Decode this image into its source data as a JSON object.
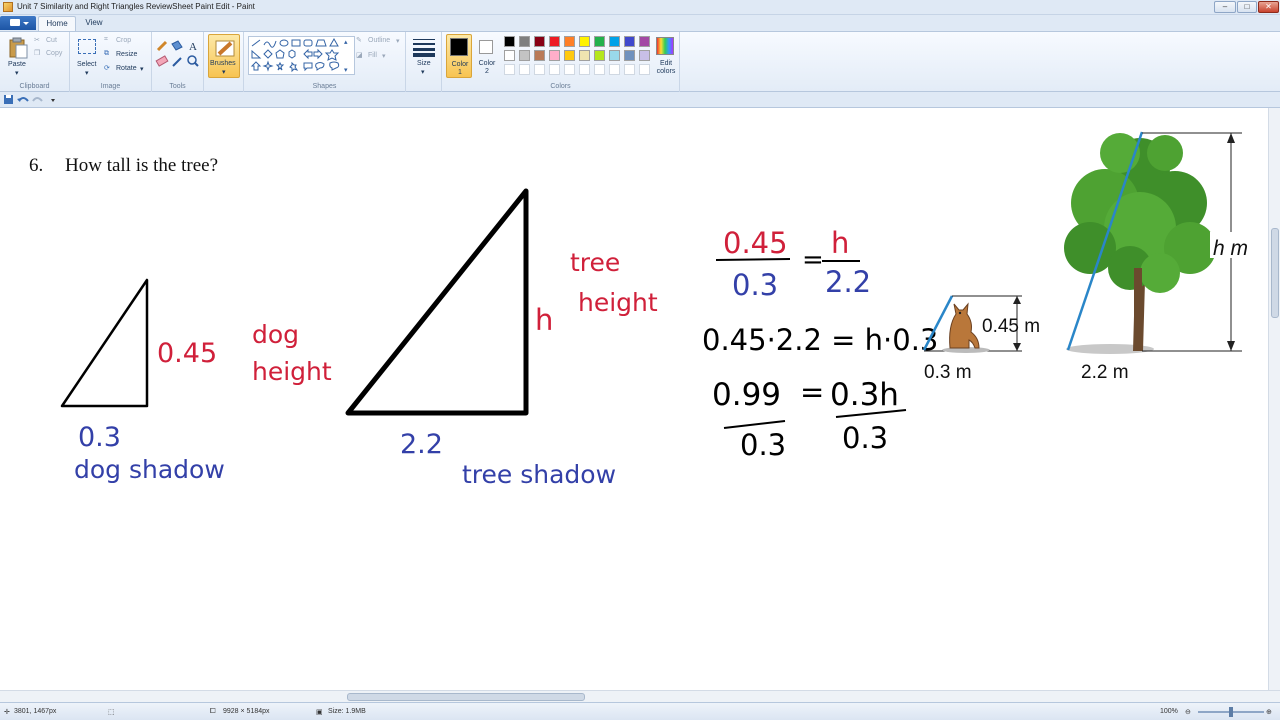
{
  "window": {
    "title": "Unit 7 Similarity and Right Triangles ReviewSheet Paint Edit - Paint"
  },
  "tabs": {
    "home": "Home",
    "view": "View"
  },
  "ribbon": {
    "clipboard": {
      "paste": "Paste",
      "cut": "Cut",
      "copy": "Copy",
      "label": "Clipboard"
    },
    "image": {
      "select": "Select",
      "crop": "Crop",
      "resize": "Resize",
      "rotate": "Rotate",
      "label": "Image"
    },
    "tools": {
      "label": "Tools"
    },
    "brushes": {
      "label": "Brushes"
    },
    "shapes": {
      "outline": "Outline",
      "fill": "Fill",
      "label": "Shapes"
    },
    "size": {
      "label": "Size"
    },
    "colors": {
      "color1": "Color 1",
      "color2": "Color 2",
      "edit": "Edit colors",
      "label": "Colors",
      "palette": [
        "#000000",
        "#7f7f7f",
        "#880015",
        "#ed1c24",
        "#ff7f27",
        "#fff200",
        "#22b14c",
        "#00a2e8",
        "#3f48cc",
        "#a349a4",
        "#ffffff",
        "#c3c3c3",
        "#b97a57",
        "#ffaec9",
        "#ffc90e",
        "#efe4b0",
        "#b5e61d",
        "#99d9ea",
        "#7092be",
        "#c8bfe7"
      ]
    }
  },
  "canvas": {
    "question_number": "6.",
    "question_text": "How tall is the tree?",
    "small_triangle": {
      "side": "0.45",
      "base": "0.3",
      "side_note_1": "dog",
      "side_note_2": "height",
      "base_note": "dog shadow"
    },
    "large_triangle": {
      "side": "h",
      "base": "2.2",
      "side_note_1": "tree",
      "side_note_2": "height",
      "base_note": "tree shadow"
    },
    "work": {
      "line1_num_left": "0.45",
      "line1_den_left": "0.3",
      "line1_eq": "=",
      "line1_num_right": "h",
      "line1_den_right": "2.2",
      "line2": "0.45·2.2 = h·0.3",
      "line3_left": "0.99",
      "line3_eq": "=",
      "line3_right": "0.3h",
      "line3_den_left": "0.3",
      "line3_den_right": "0.3"
    },
    "figure": {
      "dog_height": "0.45 m",
      "dog_shadow": "0.3 m",
      "tree_height": "h m",
      "tree_shadow": "2.2 m"
    }
  },
  "status": {
    "cursor": "3801, 1467px",
    "dimensions": "9928 × 5184px",
    "size": "Size: 1.9MB",
    "zoom": "100%"
  }
}
